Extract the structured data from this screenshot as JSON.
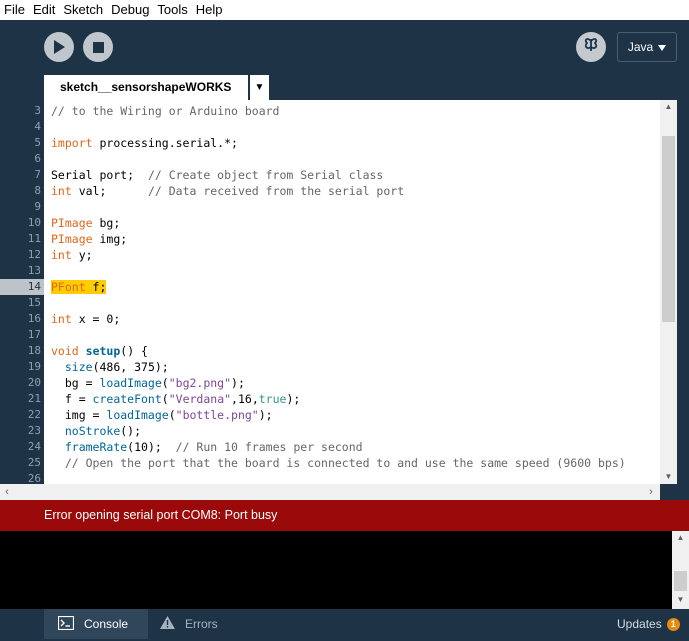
{
  "menu": [
    "File",
    "Edit",
    "Sketch",
    "Debug",
    "Tools",
    "Help"
  ],
  "toolbar": {
    "run_icon": "play-icon",
    "stop_icon": "stop-icon",
    "debug_icon": "butterfly-icon",
    "mode_label": "Java"
  },
  "tab": {
    "name": "sketch__sensorshapeWORKS",
    "menu_glyph": "▼"
  },
  "editor": {
    "current_line": 14,
    "lines": [
      {
        "num": "3",
        "html": "<span class=\"tok-comment\">// to the Wiring or Arduino board</span>"
      },
      {
        "num": "4",
        "html": ""
      },
      {
        "num": "5",
        "html": "<span class=\"tok-kw\">import</span> processing.serial.*;"
      },
      {
        "num": "6",
        "html": ""
      },
      {
        "num": "7",
        "html": "Serial port;  <span class=\"tok-comment\">// Create object from Serial class</span>"
      },
      {
        "num": "8",
        "html": "<span class=\"tok-kw\">int</span> val;      <span class=\"tok-comment\">// Data received from the serial port</span>"
      },
      {
        "num": "9",
        "html": ""
      },
      {
        "num": "10",
        "html": "<span class=\"tok-kw\">PImage</span> bg;"
      },
      {
        "num": "11",
        "html": "<span class=\"tok-kw\">PImage</span> img;"
      },
      {
        "num": "12",
        "html": "<span class=\"tok-kw\">int</span> y;"
      },
      {
        "num": "13",
        "html": ""
      },
      {
        "num": "14",
        "html": "<span class=\"sel\"><span class=\"tok-kw\">PFont</span> f;</span>"
      },
      {
        "num": "15",
        "html": ""
      },
      {
        "num": "16",
        "html": "<span class=\"tok-kw\">int</span> x = 0;"
      },
      {
        "num": "17",
        "html": ""
      },
      {
        "num": "18",
        "html": "<span class=\"tok-kw\">void</span> <span class=\"tok-fn-def\">setup</span>() {"
      },
      {
        "num": "19",
        "html": "  <span class=\"tok-fn\">size</span>(486, 375);"
      },
      {
        "num": "20",
        "html": "  bg = <span class=\"tok-fn\">loadImage</span>(<span class=\"tok-str\">\"bg2.png\"</span>);"
      },
      {
        "num": "21",
        "html": "  f = <span class=\"tok-fn\">createFont</span>(<span class=\"tok-str\">\"Verdana\"</span>,16,<span class=\"tok-lit\">true</span>);"
      },
      {
        "num": "22",
        "html": "  img = <span class=\"tok-fn\">loadImage</span>(<span class=\"tok-str\">\"bottle.png\"</span>);"
      },
      {
        "num": "23",
        "html": "  <span class=\"tok-fn\">noStroke</span>();"
      },
      {
        "num": "24",
        "html": "  <span class=\"tok-fn\">frameRate</span>(10);  <span class=\"tok-comment\">// Run 10 frames per second</span>"
      },
      {
        "num": "25",
        "html": "  <span class=\"tok-comment\">// Open the port that the board is connected to and use the same speed (9600 bps)</span>"
      },
      {
        "num": "26",
        "html": ""
      }
    ]
  },
  "status": {
    "message": "Error opening serial port COM8: Port busy",
    "color": "#9b0a0a"
  },
  "console": {
    "text": ""
  },
  "footer": {
    "console_label": "Console",
    "errors_label": "Errors",
    "updates_label": "Updates",
    "updates_count": "1"
  },
  "colors": {
    "chrome": "#1e3346",
    "keyword": "#e2661a",
    "function": "#006699",
    "string": "#7d4793",
    "comment": "#666666",
    "selection": "#ffcc00",
    "badge": "#e8890c"
  }
}
